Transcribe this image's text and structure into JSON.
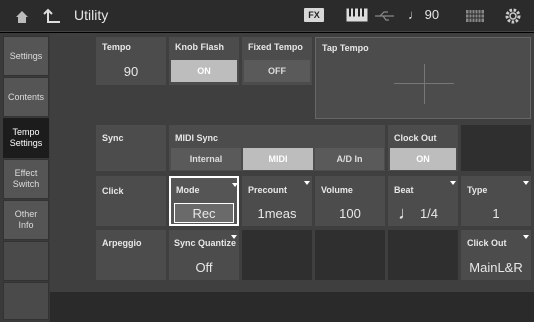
{
  "header": {
    "title": "Utility",
    "fx_badge": "FX",
    "tempo_display": "♩ 90",
    "icons": [
      "home-icon",
      "back-icon",
      "keyboard-icon",
      "usb-icon",
      "grid-icon",
      "gear-icon"
    ]
  },
  "sidebar": {
    "items": [
      {
        "label": "Settings"
      },
      {
        "label": "Contents"
      },
      {
        "label": "Tempo\nSettings",
        "active": true
      },
      {
        "label": "Effect\nSwitch"
      },
      {
        "label": "Other\nInfo"
      }
    ]
  },
  "tempo": {
    "label": "Tempo",
    "value": "90"
  },
  "knob_flash": {
    "label": "Knob Flash",
    "value": "ON"
  },
  "fixed_tempo": {
    "label": "Fixed Tempo",
    "value": "OFF"
  },
  "tap_tempo": {
    "label": "Tap Tempo"
  },
  "sync": {
    "label": "Sync",
    "midi_sync_label": "MIDI Sync",
    "options": [
      "Internal",
      "MIDI",
      "A/D In"
    ],
    "selected": "MIDI",
    "clock_out_label": "Clock Out",
    "clock_out_value": "ON"
  },
  "click": {
    "label": "Click",
    "mode_label": "Mode",
    "mode_value": "Rec",
    "precount_label": "Precount",
    "precount_value": "1meas",
    "volume_label": "Volume",
    "volume_value": "100",
    "beat_label": "Beat",
    "beat_value": "1/4",
    "type_label": "Type",
    "type_value": "1"
  },
  "arpeggio": {
    "label": "Arpeggio",
    "sync_quantize_label": "Sync Quantize",
    "sync_quantize_value": "Off",
    "click_out_label": "Click Out",
    "click_out_value": "MainL&R"
  },
  "colors": {
    "panel": "#4c4c4c",
    "on_button": "#bdbdbd",
    "background": "#3f3f3f"
  }
}
